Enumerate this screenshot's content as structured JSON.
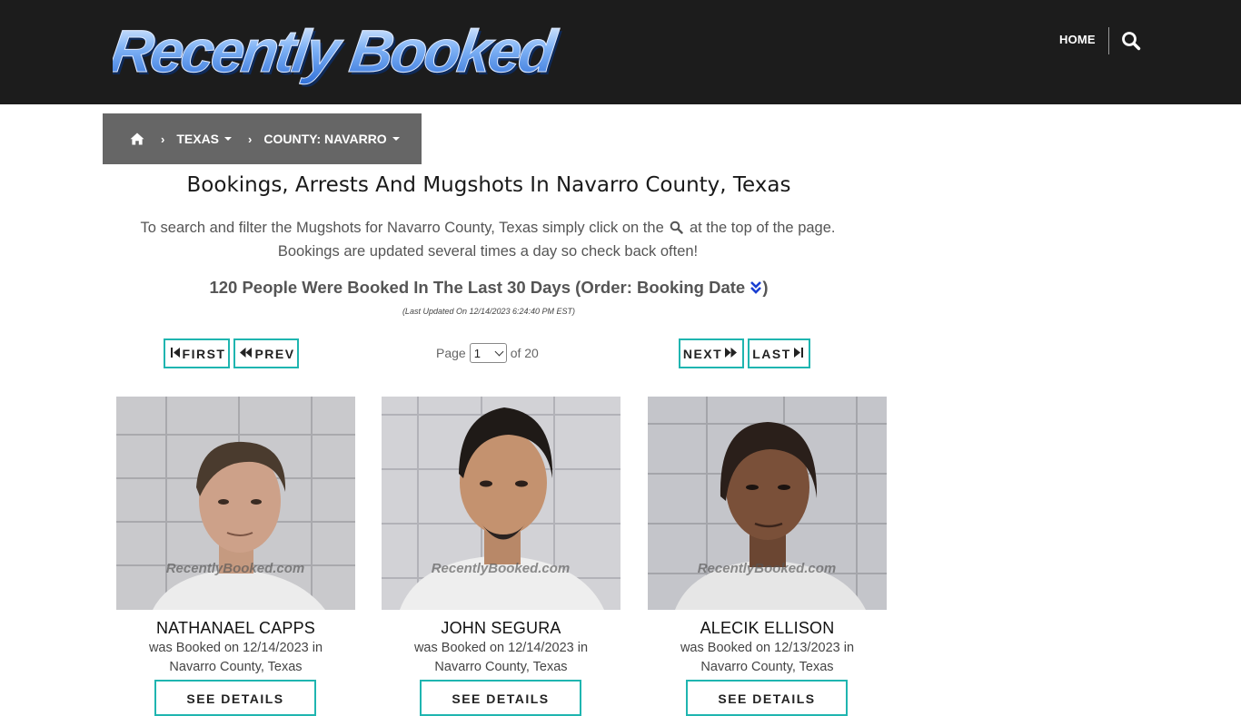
{
  "header": {
    "logo_text": "Recently Booked",
    "nav_home": "HOME",
    "search_icon": "search-icon"
  },
  "breadcrumb": {
    "home_icon": "home-icon",
    "items": [
      "TEXAS",
      "COUNTY: NAVARRO"
    ]
  },
  "main": {
    "title": "Bookings, Arrests And Mugshots In Navarro County, Texas",
    "intro_part1": "To search and filter the Mugshots for Navarro County, Texas simply click on the",
    "intro_part2": "at the top of the page.",
    "intro_line2": "Bookings are updated several times a day so check back often!",
    "count_text": "120 People Were Booked In The Last 30 Days (Order: Booking Date",
    "count_close": ")",
    "last_updated": "(Last Updated On 12/14/2023 6:24:40 PM EST)"
  },
  "pagination": {
    "first": "FIRST",
    "prev": "PREV",
    "next": "NEXT",
    "last": "LAST",
    "page_label": "Page",
    "current_page": "1",
    "of_label": "of 20"
  },
  "cards": [
    {
      "name": "NATHANAEL CAPPS",
      "line1": "was Booked on 12/14/2023 in",
      "line2": "Navarro County, Texas",
      "button": "SEE DETAILS",
      "watermark": "RecentlyBooked.com"
    },
    {
      "name": "JOHN SEGURA",
      "line1": "was Booked on 12/14/2023 in",
      "line2": "Navarro County, Texas",
      "button": "SEE DETAILS",
      "watermark": "RecentlyBooked.com"
    },
    {
      "name": "ALECIK ELLISON",
      "line1": "was Booked on 12/13/2023 in",
      "line2": "Navarro County, Texas",
      "button": "SEE DETAILS",
      "watermark": "RecentlyBooked.com"
    }
  ],
  "colors": {
    "header_bg": "#1c1c1c",
    "breadcrumb_bg": "#666666",
    "accent": "#1fb5b0",
    "order_icon": "#1a3fd1"
  }
}
